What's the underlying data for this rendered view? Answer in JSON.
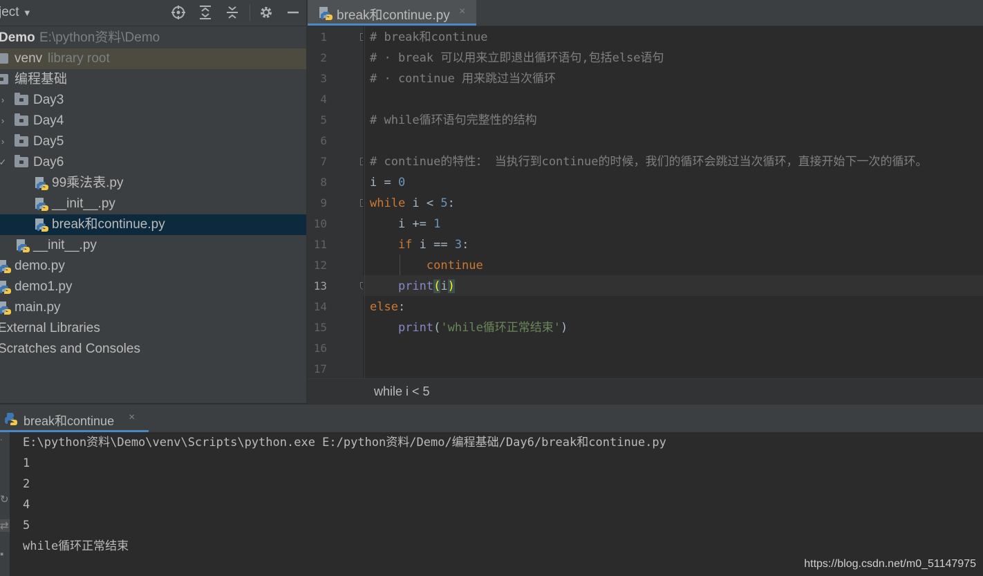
{
  "project": {
    "title": "ject",
    "tree": [
      {
        "label": "Demo",
        "extra": "E:\\python资料\\Demo"
      },
      {
        "label": "venv",
        "extra": "library root"
      },
      {
        "label": "编程基础"
      },
      {
        "label": "Day3"
      },
      {
        "label": "Day4"
      },
      {
        "label": "Day5"
      },
      {
        "label": "Day6"
      },
      {
        "label": "99乘法表.py"
      },
      {
        "label": "__init__.py"
      },
      {
        "label": "break和continue.py"
      },
      {
        "label": "__init__.py"
      },
      {
        "label": "demo.py"
      },
      {
        "label": "demo1.py"
      },
      {
        "label": "main.py"
      },
      {
        "label": "External Libraries"
      },
      {
        "label": "Scratches and Consoles"
      }
    ]
  },
  "editor": {
    "tab_label": "break和continue.py",
    "tab_close": "×",
    "line_numbers": [
      "1",
      "2",
      "3",
      "4",
      "5",
      "6",
      "7",
      "8",
      "9",
      "10",
      "11",
      "12",
      "13",
      "14",
      "15",
      "16",
      "17"
    ],
    "current_line": "13",
    "code": {
      "l1": "# break和continue",
      "l2": "# · break 可以用来立即退出循环语句,包括else语句",
      "l3": "# · continue 用来跳过当次循环",
      "l5": "# while循环语句完整性的结构",
      "l7": "# continue的特性： 当执行到continue的时候，我们的循环会跳过当次循环，直接开始下一次的循环。",
      "l8_var": "i",
      "l8_op": " = ",
      "l8_num": "0",
      "l9_kw": "while",
      "l9_rest": " i < ",
      "l9_num": "5",
      "l9_colon": ":",
      "l10_rest": "    i += ",
      "l10_num": "1",
      "l11_kw": "    if",
      "l11_rest": " i == ",
      "l11_num": "3",
      "l11_colon": ":",
      "l12_kw": "        continue",
      "l13_indent": "    ",
      "l13_fn": "print",
      "l13_open": "(",
      "l13_arg": "i",
      "l13_close": ")",
      "l14_kw": "else",
      "l14_colon": ":",
      "l15_indent": "    ",
      "l15_fn": "print",
      "l15_open": "(",
      "l15_str": "'while循环正常结束'",
      "l15_close": ")"
    },
    "breadcrumb": "while i < 5"
  },
  "run": {
    "tab_label": "break和continue",
    "tab_close": "×",
    "output": [
      "E:\\python资料\\Demo\\venv\\Scripts\\python.exe E:/python资料/Demo/编程基础/Day6/break和continue.py",
      "1",
      "2",
      "4",
      "5",
      "while循环正常结束"
    ]
  },
  "watermark": "https://blog.csdn.net/m0_51147975",
  "colors": {
    "background": "#2b2b2b",
    "panel": "#3c3f41",
    "selection": "#0d293e",
    "accent": "#4a88c7",
    "keyword": "#cc7832",
    "number": "#6897bb",
    "string": "#6a8759",
    "comment": "#808080"
  },
  "icons": [
    "locate-icon",
    "expand-all-icon",
    "collapse-all-icon",
    "gear-icon",
    "minimize-icon",
    "folder-icon",
    "python-file-icon"
  ]
}
